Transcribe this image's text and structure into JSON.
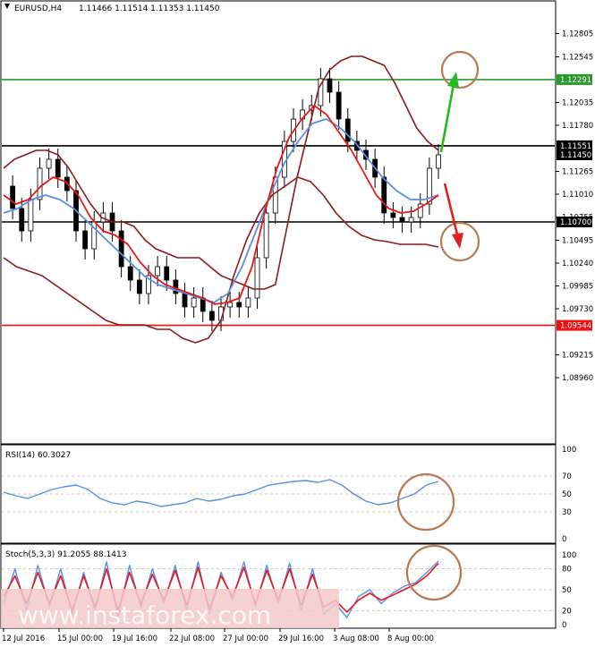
{
  "main_header": {
    "symbol": "EURUSD,H4",
    "ohlc": "1.11466 1.11514 1.11353 1.11450"
  },
  "rsi_header": "RSI(14) 60.3027",
  "stoch_header": "Stoch(5,3,3) 91.2055 88.1413",
  "watermark": "www.instaforex.com",
  "colors": {
    "green_level": "#2a9a2a",
    "red_level": "#ee1111",
    "black_level": "#000000",
    "bands": "#8b1a1a",
    "ma_red": "#e81818",
    "ma_blue": "#5a8ee8",
    "arrow_green": "#22bb22",
    "arrow_red": "#e02020",
    "circle": "#b87850",
    "oscillator": "#5a8ee8",
    "stoch_signal": "#e81818"
  },
  "chart_data": {
    "type": "line",
    "price_axis": {
      "ylim": [
        1.088,
        1.13
      ],
      "ticks": [
        "1.12805",
        "1.12545",
        "1.12035",
        "1.11780",
        "1.11265",
        "1.11010",
        "1.10755",
        "1.10495",
        "1.10240",
        "1.09985",
        "1.09730",
        "1.09215",
        "1.08960"
      ]
    },
    "level_tags": [
      {
        "label": "1.12291",
        "color": "green"
      },
      {
        "label": "1.11551",
        "color": "black"
      },
      {
        "label": "1.11450",
        "color": "black"
      },
      {
        "label": "1.10700",
        "color": "black"
      },
      {
        "label": "1.09544",
        "color": "red"
      }
    ],
    "horizontal_levels": [
      {
        "value": 1.12291,
        "color": "green"
      },
      {
        "value": 1.11551,
        "color": "black"
      },
      {
        "value": 1.107,
        "color": "black"
      },
      {
        "value": 1.09544,
        "color": "red"
      }
    ],
    "x_labels": [
      "12 Jul 2016",
      "15 Jul 00:00",
      "19 Jul 16:00",
      "22 Jul 08:00",
      "27 Jul 00:00",
      "29 Jul 16:00",
      "3 Aug 08:00",
      "8 Aug 00:00"
    ],
    "price": [
      1.111,
      1.1085,
      1.106,
      1.1095,
      1.113,
      1.114,
      1.112,
      1.1105,
      1.106,
      1.104,
      1.107,
      1.108,
      1.106,
      1.102,
      1.1005,
      1.099,
      1.101,
      1.102,
      1.1005,
      1.099,
      1.0975,
      1.0985,
      1.097,
      1.096,
      1.0975,
      1.098,
      1.0975,
      1.0985,
      1.103,
      1.108,
      1.112,
      1.116,
      1.1185,
      1.1195,
      1.12,
      1.123,
      1.1215,
      1.1185,
      1.116,
      1.115,
      1.114,
      1.112,
      1.108,
      1.1075,
      1.107,
      1.1075,
      1.109,
      1.113,
      1.1145
    ],
    "bands_upper": [
      1.113,
      1.114,
      1.1145,
      1.115,
      1.115,
      1.1145,
      1.113,
      1.111,
      1.109,
      1.1075,
      1.107,
      1.107,
      1.1065,
      1.105,
      1.104,
      1.1035,
      1.103,
      1.103,
      1.103,
      1.102,
      1.101,
      1.1005,
      1.1,
      1.0995,
      1.0995,
      1.1,
      1.106,
      1.112,
      1.117,
      1.122,
      1.124,
      1.125,
      1.1255,
      1.1255,
      1.125,
      1.1245,
      1.1225,
      1.12,
      1.1175,
      1.116,
      1.115
    ],
    "bands_lower": [
      1.103,
      1.102,
      1.1015,
      1.101,
      1.1,
      1.099,
      1.098,
      1.097,
      1.096,
      1.0955,
      1.0955,
      1.0955,
      1.095,
      1.095,
      1.094,
      1.0935,
      1.094,
      1.096,
      1.101,
      1.105,
      1.108,
      1.11,
      1.111,
      1.112,
      1.1115,
      1.11,
      1.108,
      1.1065,
      1.1055,
      1.105,
      1.1048,
      1.1045,
      1.1045,
      1.1045,
      1.1042
    ],
    "ma_red": [
      1.11,
      1.109,
      1.1095,
      1.111,
      1.112,
      1.1115,
      1.11,
      1.1075,
      1.106,
      1.1055,
      1.1045,
      1.1025,
      1.101,
      1.1,
      1.0995,
      1.099,
      1.0985,
      1.0978,
      1.098,
      1.0985,
      1.102,
      1.108,
      1.113,
      1.1165,
      1.1185,
      1.12,
      1.119,
      1.117,
      1.115,
      1.1125,
      1.11,
      1.1085,
      1.108,
      1.1082,
      1.109,
      1.11
    ],
    "ma_blue": [
      1.108,
      1.1085,
      1.1095,
      1.11,
      1.1095,
      1.1085,
      1.107,
      1.1055,
      1.104,
      1.1025,
      1.101,
      1.1,
      1.0995,
      1.099,
      1.0985,
      1.098,
      1.099,
      1.102,
      1.106,
      1.11,
      1.1135,
      1.116,
      1.118,
      1.1185,
      1.1175,
      1.116,
      1.114,
      1.112,
      1.1105,
      1.1095,
      1.1095,
      1.11
    ],
    "rsi": {
      "ylim": [
        0,
        100
      ],
      "ticks": [
        "100",
        "70",
        "50",
        "30",
        "0"
      ],
      "values": [
        52,
        48,
        45,
        50,
        55,
        58,
        60,
        55,
        45,
        40,
        38,
        42,
        40,
        36,
        38,
        40,
        45,
        42,
        44,
        48,
        50,
        55,
        60,
        62,
        64,
        65,
        63,
        66,
        60,
        50,
        42,
        38,
        40,
        45,
        50,
        60,
        64
      ]
    },
    "stoch": {
      "ylim": [
        0,
        100
      ],
      "ticks": [
        "100",
        "80",
        "50",
        "20",
        "0"
      ],
      "main": [
        30,
        80,
        20,
        85,
        25,
        80,
        15,
        75,
        20,
        90,
        10,
        85,
        25,
        80,
        30,
        85,
        20,
        90,
        15,
        75,
        35,
        90,
        25,
        85,
        30,
        88,
        20,
        80,
        15,
        30,
        10,
        40,
        50,
        30,
        45,
        55,
        60,
        75,
        91
      ],
      "signal": [
        40,
        70,
        30,
        75,
        30,
        70,
        20,
        70,
        25,
        80,
        20,
        75,
        30,
        72,
        35,
        78,
        28,
        82,
        22,
        70,
        40,
        82,
        30,
        78,
        35,
        80,
        28,
        72,
        25,
        35,
        18,
        35,
        45,
        35,
        42,
        50,
        58,
        70,
        88
      ]
    }
  }
}
